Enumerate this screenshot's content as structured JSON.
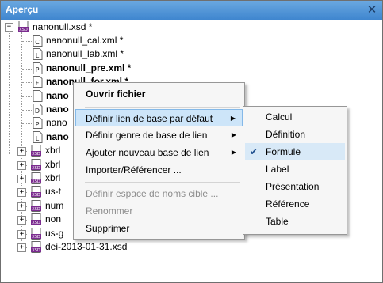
{
  "window": {
    "title": "Aperçu",
    "close_glyph": "✕"
  },
  "tree": {
    "root": {
      "label": "nanonull.xsd *",
      "icon": "xsd-file-icon"
    },
    "children": [
      {
        "label": "nanonull_cal.xml *",
        "icon": "calc-linkbase-icon",
        "letter": "C",
        "bold": false
      },
      {
        "label": "nanonull_lab.xml *",
        "icon": "label-linkbase-icon",
        "letter": "L",
        "bold": false
      },
      {
        "label": "nanonull_pre.xml *",
        "icon": "presentation-linkbase-icon",
        "letter": "P",
        "bold": true
      },
      {
        "label": "nanonull_for.xml *",
        "icon": "formula-linkbase-icon",
        "letter": "F",
        "bold": true
      },
      {
        "label": "nano",
        "icon": "linkbase-icon",
        "letter": "",
        "bold": true
      },
      {
        "label": "nano",
        "icon": "definition-linkbase-icon",
        "letter": "D",
        "bold": true
      },
      {
        "label": "nano",
        "icon": "presentation-linkbase-icon",
        "letter": "P",
        "bold": false
      },
      {
        "label": "nano",
        "icon": "label-linkbase-icon",
        "letter": "L",
        "bold": true
      },
      {
        "label": "xbrl",
        "icon": "xsd-file-icon",
        "bold": false
      },
      {
        "label": "xbrl",
        "icon": "xsd-file-icon",
        "bold": false
      },
      {
        "label": "xbrl",
        "icon": "xsd-file-icon",
        "bold": false
      },
      {
        "label": "us-t",
        "icon": "xsd-file-icon",
        "bold": false
      },
      {
        "label": "num",
        "icon": "xsd-file-icon",
        "bold": false
      },
      {
        "label": "non",
        "icon": "xsd-file-icon",
        "bold": false
      },
      {
        "label": "us-g",
        "icon": "xsd-file-icon",
        "bold": false
      },
      {
        "label": "dei-2013-01-31.xsd",
        "icon": "xsd-file-icon",
        "bold": false
      }
    ]
  },
  "context_menu": {
    "items": [
      {
        "label": "Ouvrir fichier",
        "bold": true
      },
      {
        "label": "Définir lien de base par défaut",
        "submenu": true,
        "highlighted": true
      },
      {
        "label": "Définir genre de base de lien",
        "submenu": true
      },
      {
        "label": "Ajouter nouveau base de lien",
        "submenu": true
      },
      {
        "label": "Importer/Référencer ..."
      },
      {
        "label": "Définir espace de noms cible ...",
        "disabled": true
      },
      {
        "label": "Renommer",
        "disabled": true
      },
      {
        "label": "Supprimer"
      }
    ],
    "arrow_glyph": "▶"
  },
  "submenu": {
    "items": [
      {
        "label": "Calcul"
      },
      {
        "label": "Définition"
      },
      {
        "label": "Formule",
        "checked": true
      },
      {
        "label": "Label"
      },
      {
        "label": "Présentation"
      },
      {
        "label": "Référence"
      },
      {
        "label": "Table"
      }
    ],
    "check_glyph": "✔"
  },
  "colors": {
    "title_bar": "#3f86cf",
    "highlight": "#cde5f9",
    "disabled_text": "#8d8d8d"
  }
}
